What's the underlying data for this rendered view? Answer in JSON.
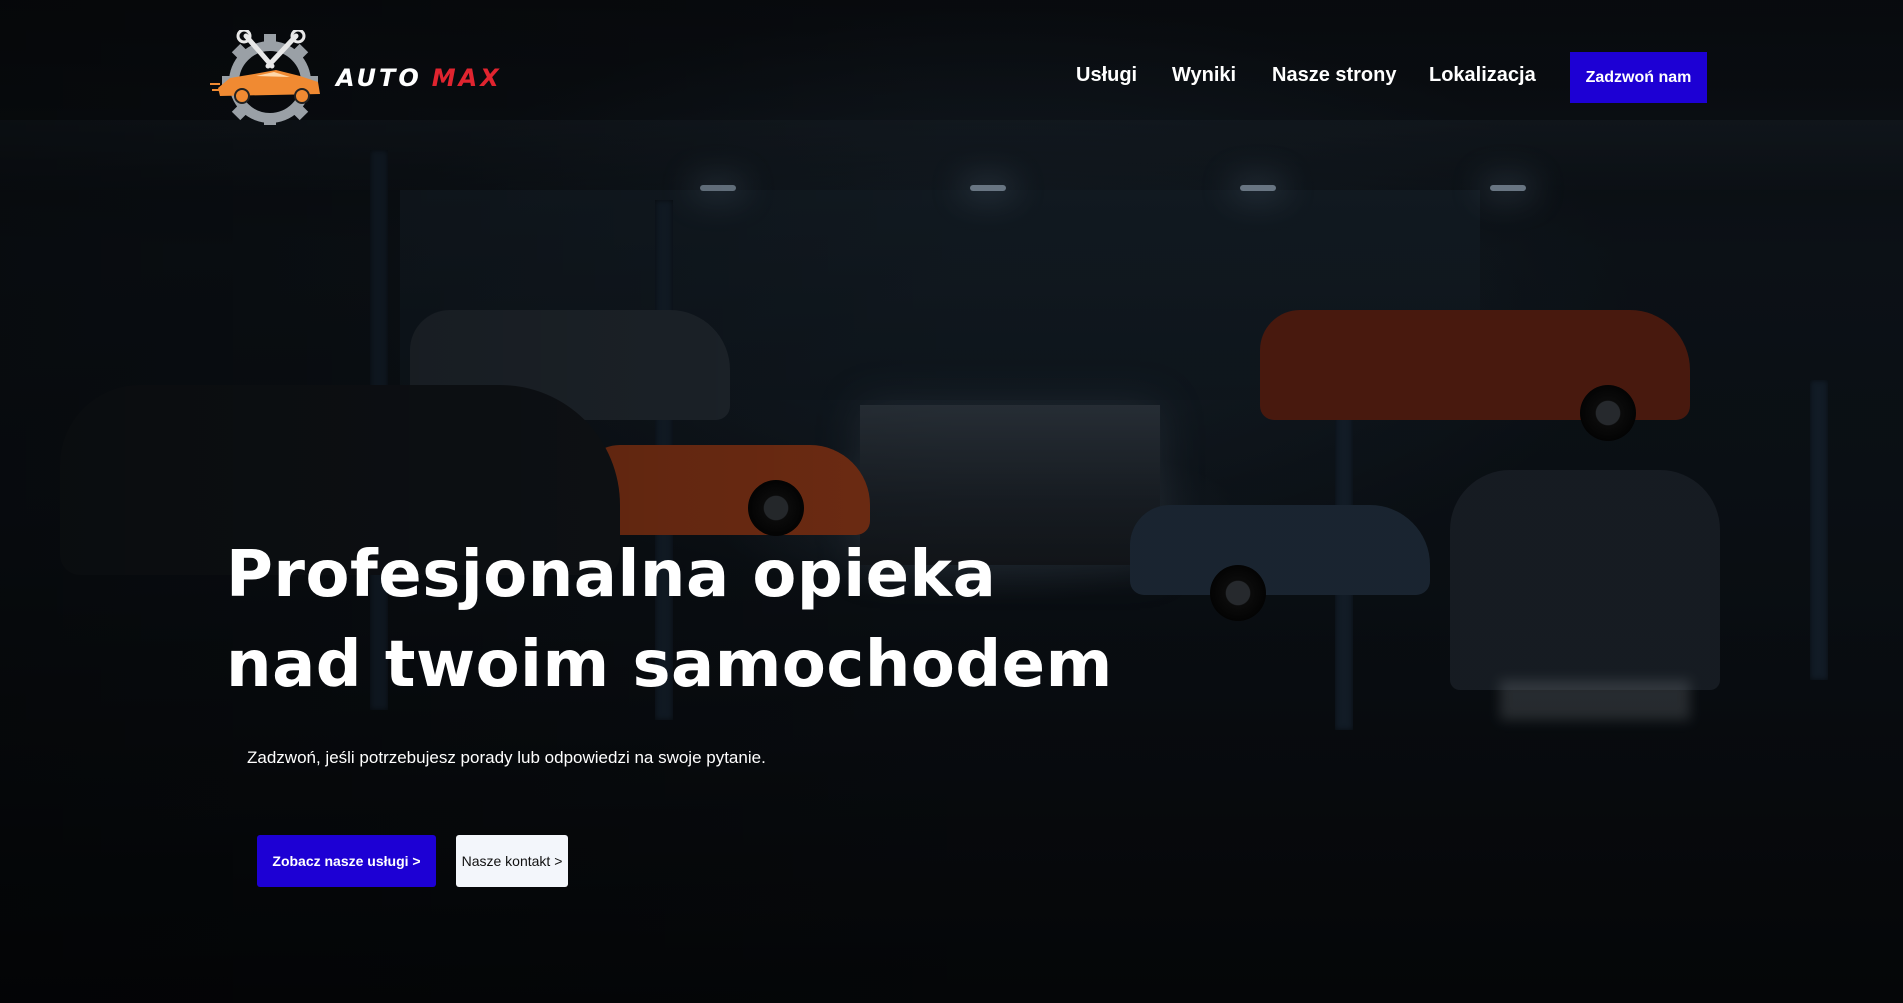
{
  "logo": {
    "word1": "AUTO",
    "word2": "MAX"
  },
  "nav": {
    "items": [
      "Usługi",
      "Wyniki",
      "Nasze strony",
      "Lokalizacja"
    ],
    "cta": "Zadzwoń nam"
  },
  "hero": {
    "headline_line1": "Profesjonalna opieka",
    "headline_line2": "nad twoim samochodem",
    "subline": "Zadzwoń, jeśli potrzebujesz porady lub odpowiedzi na swoje pytanie.",
    "primary_button": "Zobacz nasze usługi >",
    "secondary_button": "Nasze kontakt >"
  },
  "colors": {
    "accent": "#1d00d4",
    "logo_red": "#e0242f",
    "logo_orange": "#f08a32",
    "text": "#ffffff"
  },
  "icons": [
    "gear-icon",
    "wrench-icon",
    "car-icon"
  ]
}
